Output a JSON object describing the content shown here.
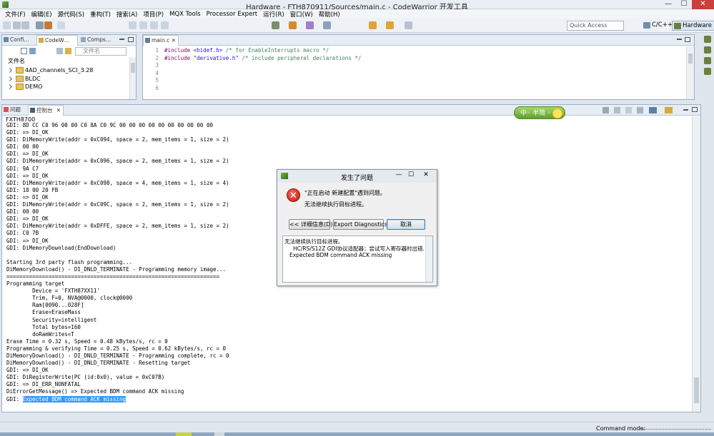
{
  "window": {
    "title": "Hardware  -  FTH870911/Sources/main.c  -  CodeWarrior 开发工具",
    "minimize": "—",
    "maximize": "☐",
    "close": "✕"
  },
  "menu": [
    "文件(F)",
    "编辑(E)",
    "源代码(S)",
    "重构(T)",
    "搜索(A)",
    "项目(P)",
    "MQX Tools",
    "Processor Expert",
    "运行(R)",
    "窗口(W)",
    "帮助(H)"
  ],
  "toolbar": {
    "quick_access": "Quick Access",
    "perspectives": [
      "C/C++",
      "Hardware"
    ]
  },
  "project_panel": {
    "tabs": [
      "Confi…",
      "CodeW…",
      "Comps…"
    ],
    "filter_placeholder": "文件名",
    "column_header": "文件名",
    "items": [
      "4AD_channels_SCI_3.28",
      "BLDC",
      "DEMO"
    ]
  },
  "editor": {
    "tab": "main.c",
    "lines": [
      {
        "n": "1",
        "kw": "#include",
        "str": " <hidef.h>",
        "cm": " /* for EnableInterrupts macro */"
      },
      {
        "n": "2",
        "kw": "#include",
        "str": " \"derivative.h\"",
        "cm": " /* include peripheral declarations */"
      },
      {
        "n": "3",
        "kw": "",
        "str": "",
        "cm": ""
      },
      {
        "n": "4",
        "kw": "",
        "str": "",
        "cm": ""
      },
      {
        "n": "5",
        "kw": "",
        "str": "",
        "cm": ""
      },
      {
        "n": "6",
        "kw": "",
        "str": "",
        "cm": ""
      }
    ]
  },
  "console": {
    "tabs": [
      "问题",
      "控制台"
    ],
    "label": "FXTH8700",
    "lines": [
      "GDI: 8D CC C0 96 00 00 C0 8A C0 9C 00 00 00 00 00 00 00 00 00 00",
      "GDI: => DI_OK",
      "GDI: DiMemoryWrite(addr = 0xC094, space = 2, mem_items = 1, size = 2)",
      "GDI: 00 00",
      "GDI: => DI_OK",
      "GDI: DiMemoryWrite(addr = 0xC096, space = 2, mem_items = 1, size = 2)",
      "GDI: 9A C7",
      "GDI: => DI_OK",
      "GDI: DiMemoryWrite(addr = 0xC098, space = 4, mem_items = 1, size = 4)",
      "GDI: 18 00 20 FB",
      "GDI: => DI_OK",
      "GDI: DiMemoryWrite(addr = 0xC09C, space = 2, mem_items = 1, size = 2)",
      "GDI: 00 00",
      "GDI: => DI_OK",
      "GDI: DiMemoryWrite(addr = 0xDFFE, space = 2, mem_items = 1, size = 2)",
      "GDI: C0 7B",
      "GDI: => DI_OK",
      "GDI: DiMemoryDownload(EndDownload)",
      "",
      "Starting 3rd party flash programming...",
      "DiMemoryDownload() - DI_DNLD_TERMINATE - Programming memory image...",
      "==================================================================",
      "Programming target",
      "        Device = 'FXTH87XX11'",
      "        Trim, F=0, NVA@0000, clock@0000",
      "        Ram[0090...028F]",
      "        Erase=EraseMass",
      "        Security=intelligent",
      "        Total bytes=160",
      "        doRamWrites=T",
      "Erase Time = 0.32 s, Speed = 0.48 kBytes/s, rc = 0",
      "Programming & verifying Time = 0.25 s, Speed = 0.62 kBytes/s, rc = 0",
      "DiMemoryDownload() - DI_DNLD_TERMINATE - Programming complete, rc = 0",
      "DiMemoryDownload() - DI_DNLD_TERMINATE - Resetting target",
      "GDI: => DI_OK",
      "GDI: DiRegisterWrite(PC (id:0x0), value = 0xC07B)",
      "GDI: => DI_ERR_NONFATAL",
      "DiErrorGetMessage() => Expected BDM command ACK missing"
    ],
    "last_prefix": "GDI: ",
    "last_highlight": "Expected BDM command ACK missing"
  },
  "ime": {
    "label": "中◦ 半简 ◦"
  },
  "dialog": {
    "title": "发生了问题",
    "message": "\"正在启动 新建配置\"遇到问题。",
    "submessage": "无法继续执行目标进程。",
    "buttons": {
      "details": "<< 详细信息(D)",
      "export": "Export Diagnostics",
      "cancel": "取消"
    },
    "details": [
      "无法继续执行目标进程。",
      "HC/RS/S12Z GDI协议适配器：尝试写入寄存器时出错.",
      "Expected BDM command ACK missing"
    ]
  },
  "statusbar": {
    "label": "Command mode:"
  },
  "colors": {
    "accent": "#3399ff",
    "error": "#c01812",
    "keyword": "#7f0055",
    "string": "#2a00ff",
    "comment": "#3f7f5f"
  }
}
